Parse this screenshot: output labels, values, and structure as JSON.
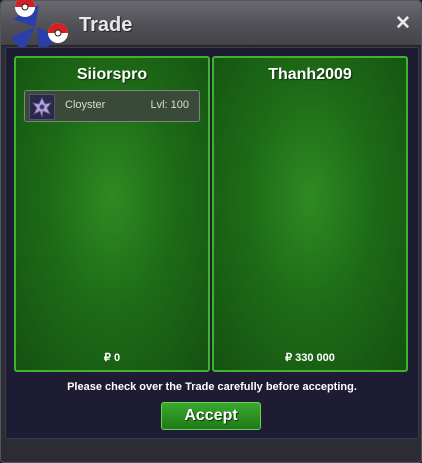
{
  "window": {
    "title": "Trade",
    "close_icon": "close-icon"
  },
  "left_player": {
    "name": "Siiorspro",
    "items": [
      {
        "name": "Cloyster",
        "level": "Lvl: 100",
        "icon": "cloyster-icon"
      }
    ],
    "money": "₽ 0"
  },
  "right_player": {
    "name": "Thanh2009",
    "items": [],
    "money": "₽ 330 000"
  },
  "notice": "Please check over the Trade carefully before accepting.",
  "accept_label": "Accept",
  "colors": {
    "panel": "#1e6c17",
    "panel_border": "#3fb230",
    "accept": "#2a8f20"
  }
}
